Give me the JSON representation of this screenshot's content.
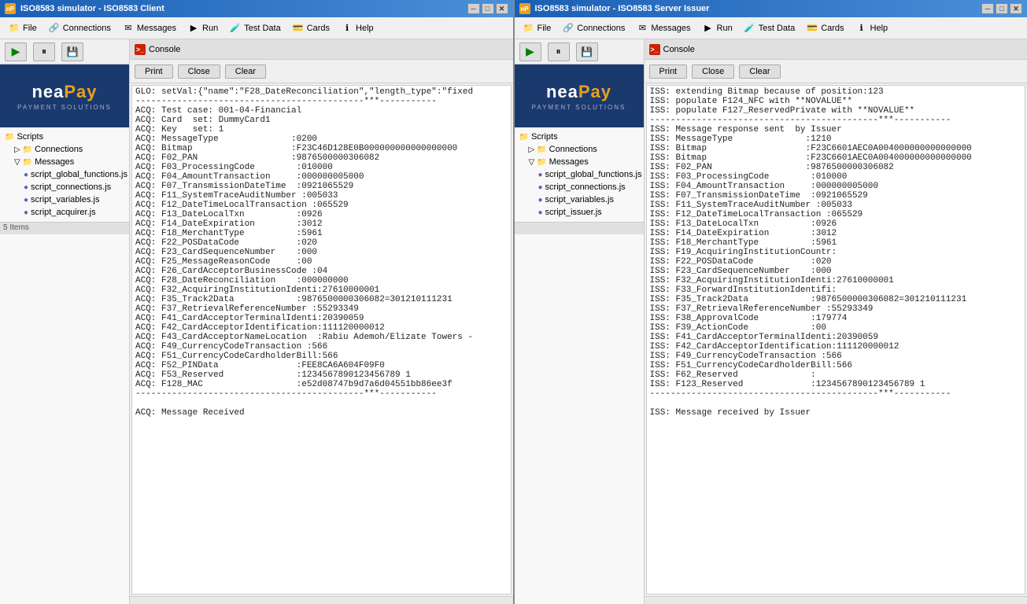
{
  "leftWindow": {
    "titleBar": {
      "appName": "neaPay",
      "title": "ISO8583 simulator - ISO8583 Client",
      "controls": [
        "─",
        "□",
        "✕"
      ]
    },
    "menuBar": [
      {
        "label": "File",
        "icon": "folder-icon"
      },
      {
        "label": "Connections",
        "icon": "connections-icon"
      },
      {
        "label": "Messages",
        "icon": "messages-icon"
      },
      {
        "label": "Run",
        "icon": "run-icon"
      },
      {
        "label": "Test Data",
        "icon": "testdata-icon"
      },
      {
        "label": "Cards",
        "icon": "cards-icon"
      },
      {
        "label": "Help",
        "icon": "help-icon"
      }
    ],
    "toolbar": {
      "play": "▶",
      "pause": "⏸",
      "save": "💾"
    },
    "sidebar": {
      "items": [
        {
          "label": "Scripts",
          "indent": 0,
          "type": "folder"
        },
        {
          "label": "Connections",
          "indent": 1,
          "type": "folder"
        },
        {
          "label": "Messages",
          "indent": 1,
          "type": "folder"
        },
        {
          "label": "script_global_functions.js",
          "indent": 2,
          "type": "file"
        },
        {
          "label": "script_connections.js",
          "indent": 2,
          "type": "file"
        },
        {
          "label": "script_variables.js",
          "indent": 2,
          "type": "file"
        },
        {
          "label": "script_acquirer.js",
          "indent": 2,
          "type": "file"
        }
      ],
      "statusText": "5 Items"
    },
    "console": {
      "title": "Console",
      "buttons": [
        "Print",
        "Close",
        "Clear"
      ],
      "output": "GLO: setVal:{\"name\":\"F28_DateReconciliation\",\"length_type\":\"fixed\n--------------------------------------------***-----------\nACQ: Test case: 001-04-Financial\nACQ: Card  set: DummyCard1\nACQ: Key   set: 1\nACQ: MessageType              :0200\nACQ: Bitmap                   :F23C46D128E0B000000000000000000\nACQ: F02_PAN                  :9876500000306082\nACQ: F03_ProcessingCode        :010000\nACQ: F04_AmountTransaction     :000000005000\nACQ: F07_TransmissionDateTime  :0921065529\nACQ: F11_SystemTraceAuditNumber :005033\nACQ: F12_DateTimeLocalTransaction :065529\nACQ: F13_DateLocalTxn          :0926\nACQ: F14_DateExpiration        :3012\nACQ: F18_MerchantType          :5961\nACQ: F22_POSDataCode           :020\nACQ: F23_CardSequenceNumber    :000\nACQ: F25_MessageReasonCode     :00\nACQ: F26_CardAcceptorBusinessCode :04\nACQ: F28_DateReconciliation    :000000000\nACQ: F32_AcquiringInstitutionIdenti:27610000001\nACQ: F35_Track2Data            :9876500000306082=301210111231\nACQ: F37_RetrievalReferenceNumber :55293349\nACQ: F41_CardAcceptorTerminalIdenti:20390059\nACQ: F42_CardAcceptorIdentification:111120000012\nACQ: F43_CardAcceptorNameLocation  :Rabiu Ademoh/Elizate Towers -\nACQ: F49_CurrencyCodeTransaction :566\nACQ: F51_CurrencyCodeCardholderBill:566\nACQ: F52_PINData               :FEE8CA6A604F09F0\nACQ: F53_Reserved              :1234567890123456789 1\nACQ: F128_MAC                  :e52d08747b9d7a6d04551bb86ee3f\n--------------------------------------------***-----------\n\nACQ: Message Received"
    }
  },
  "rightWindow": {
    "titleBar": {
      "appName": "neaPay",
      "title": "ISO8583 simulator - ISO8583 Server Issuer",
      "controls": [
        "─",
        "□",
        "✕"
      ]
    },
    "menuBar": [
      {
        "label": "File",
        "icon": "folder-icon"
      },
      {
        "label": "Connections",
        "icon": "connections-icon"
      },
      {
        "label": "Messages",
        "icon": "messages-icon"
      },
      {
        "label": "Run",
        "icon": "run-icon"
      },
      {
        "label": "Test Data",
        "icon": "testdata-icon"
      },
      {
        "label": "Cards",
        "icon": "cards-icon"
      },
      {
        "label": "Help",
        "icon": "help-icon"
      }
    ],
    "toolbar": {
      "play": "▶",
      "pause": "⏸",
      "save": "💾"
    },
    "sidebar": {
      "items": [
        {
          "label": "Scripts",
          "indent": 0,
          "type": "folder"
        },
        {
          "label": "Connections",
          "indent": 1,
          "type": "folder"
        },
        {
          "label": "Messages",
          "indent": 1,
          "type": "folder"
        },
        {
          "label": "script_global_functions.js",
          "indent": 2,
          "type": "file"
        },
        {
          "label": "script_connections.js",
          "indent": 2,
          "type": "file"
        },
        {
          "label": "script_variables.js",
          "indent": 2,
          "type": "file"
        },
        {
          "label": "script_issuer.js",
          "indent": 2,
          "type": "file"
        }
      ],
      "statusText": ""
    },
    "console": {
      "title": "Console",
      "buttons": [
        "Print",
        "Close",
        "Clear"
      ],
      "output": "ISS: extending Bitmap because of position:123\nISS: populate F124_NFC with **NOVALUE**\nISS: populate F127_ReservedPrivate with **NOVALUE**\n--------------------------------------------***-----------\nISS: Message response sent  by Issuer\nISS: MessageType              :1210\nISS: Bitmap                   :F23C6601AEC0A004000000000000000\nISS: Bitmap                   :F23C6601AEC0A004000000000000000\nISS: F02_PAN                  :9876500000306082\nISS: F03_ProcessingCode        :010000\nISS: F04_AmountTransaction     :000000005000\nISS: F07_TransmissionDateTime  :0921065529\nISS: F11_SystemTraceAuditNumber :005033\nISS: F12_DateTimeLocalTransaction :065529\nISS: F13_DateLocalTxn          :0926\nISS: F14_DateExpiration        :3012\nISS: F18_MerchantType          :5961\nISS: F19_AcquiringInstitutionCountr:\nISS: F22_POSDataCode           :020\nISS: F23_CardSequenceNumber    :000\nISS: F32_AcquiringInstitutionIdenti:27610000001\nISS: F33_ForwardInstitutionIdentifi:\nISS: F35_Track2Data            :9876500000306082=301210111231\nISS: F37_RetrievalReferenceNumber :55293349\nISS: F38_ApprovalCode          :179774\nISS: F39_ActionCode            :00\nISS: F41_CardAcceptorTerminalIdenti:20390059\nISS: F42_CardAcceptorIdentification:111120000012\nISS: F49_CurrencyCodeTransaction :566\nISS: F51_CurrencyCodeCardholderBill:566\nISS: F62_Reserved              :\nISS: F123_Reserved             :1234567890123456789 1\n--------------------------------------------***-----------\n\nISS: Message received by Issuer"
    }
  }
}
